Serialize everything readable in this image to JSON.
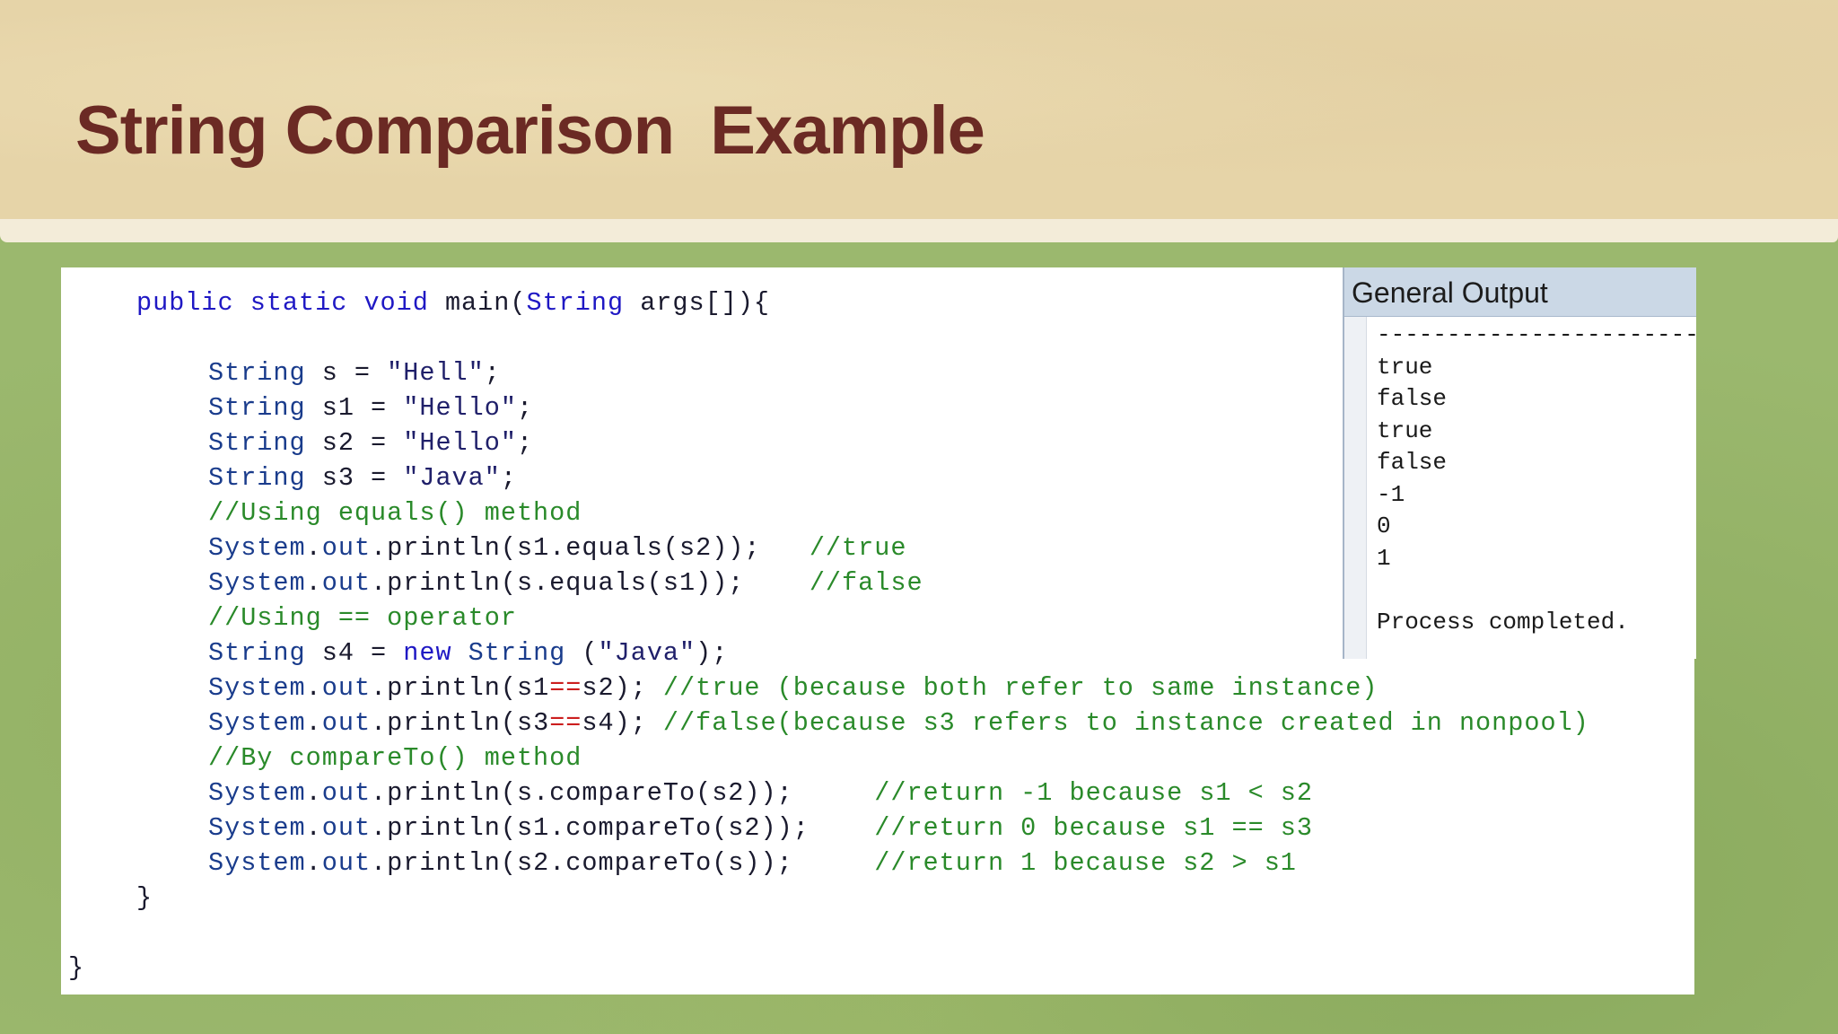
{
  "slide": {
    "title": "String Comparison  Example"
  },
  "code": {
    "lines": [
      [
        {
          "t": "public static void ",
          "c": "kw"
        },
        {
          "t": "main(",
          "c": "tx"
        },
        {
          "t": "String",
          "c": "kw"
        },
        {
          "t": " args[]){",
          "c": "tx"
        }
      ],
      [],
      [
        {
          "t": "String",
          "c": "id"
        },
        {
          "t": " s = ",
          "c": "tx"
        },
        {
          "t": "\"Hell\"",
          "c": "str"
        },
        {
          "t": ";",
          "c": "tx"
        }
      ],
      [
        {
          "t": "String",
          "c": "id"
        },
        {
          "t": " s1 = ",
          "c": "tx"
        },
        {
          "t": "\"Hello\"",
          "c": "str"
        },
        {
          "t": ";",
          "c": "tx"
        }
      ],
      [
        {
          "t": "String",
          "c": "id"
        },
        {
          "t": " s2 = ",
          "c": "tx"
        },
        {
          "t": "\"Hello\"",
          "c": "str"
        },
        {
          "t": ";",
          "c": "tx"
        }
      ],
      [
        {
          "t": "String",
          "c": "id"
        },
        {
          "t": " s3 = ",
          "c": "tx"
        },
        {
          "t": "\"Java\"",
          "c": "str"
        },
        {
          "t": ";",
          "c": "tx"
        }
      ],
      [
        {
          "t": "//Using equals() method",
          "c": "cm"
        }
      ],
      [
        {
          "t": "System",
          "c": "id"
        },
        {
          "t": ".",
          "c": "tx"
        },
        {
          "t": "out",
          "c": "id"
        },
        {
          "t": ".println(s1.equals(s2));   ",
          "c": "tx"
        },
        {
          "t": "//true",
          "c": "cm"
        }
      ],
      [
        {
          "t": "System",
          "c": "id"
        },
        {
          "t": ".",
          "c": "tx"
        },
        {
          "t": "out",
          "c": "id"
        },
        {
          "t": ".println(s.equals(s1));    ",
          "c": "tx"
        },
        {
          "t": "//false",
          "c": "cm"
        }
      ],
      [
        {
          "t": "//Using == operator",
          "c": "cm"
        }
      ],
      [
        {
          "t": "String",
          "c": "id"
        },
        {
          "t": " s4 = ",
          "c": "tx"
        },
        {
          "t": "new",
          "c": "kw"
        },
        {
          "t": " ",
          "c": "tx"
        },
        {
          "t": "String",
          "c": "id"
        },
        {
          "t": " (",
          "c": "tx"
        },
        {
          "t": "\"Java\"",
          "c": "str"
        },
        {
          "t": ");",
          "c": "tx"
        }
      ],
      [
        {
          "t": "System",
          "c": "id"
        },
        {
          "t": ".",
          "c": "tx"
        },
        {
          "t": "out",
          "c": "id"
        },
        {
          "t": ".println(s1",
          "c": "tx"
        },
        {
          "t": "==",
          "c": "op"
        },
        {
          "t": "s2); ",
          "c": "tx"
        },
        {
          "t": "//true (because both refer to same instance)",
          "c": "cm"
        }
      ],
      [
        {
          "t": "System",
          "c": "id"
        },
        {
          "t": ".",
          "c": "tx"
        },
        {
          "t": "out",
          "c": "id"
        },
        {
          "t": ".println(s3",
          "c": "tx"
        },
        {
          "t": "==",
          "c": "op"
        },
        {
          "t": "s4); ",
          "c": "tx"
        },
        {
          "t": "//false(because s3 refers to instance created in nonpool)",
          "c": "cm"
        }
      ],
      [
        {
          "t": "//By compareTo() method",
          "c": "cm"
        }
      ],
      [
        {
          "t": "System",
          "c": "id"
        },
        {
          "t": ".",
          "c": "tx"
        },
        {
          "t": "out",
          "c": "id"
        },
        {
          "t": ".println(s.compareTo(s2));     ",
          "c": "tx"
        },
        {
          "t": "//return -1 because s1 < s2",
          "c": "cm"
        }
      ],
      [
        {
          "t": "System",
          "c": "id"
        },
        {
          "t": ".",
          "c": "tx"
        },
        {
          "t": "out",
          "c": "id"
        },
        {
          "t": ".println(s1.compareTo(s2));    ",
          "c": "tx"
        },
        {
          "t": "//return 0 because s1 == s3",
          "c": "cm"
        }
      ],
      [
        {
          "t": "System",
          "c": "id"
        },
        {
          "t": ".",
          "c": "tx"
        },
        {
          "t": "out",
          "c": "id"
        },
        {
          "t": ".println(s2.compareTo(s));     ",
          "c": "tx"
        },
        {
          "t": "//return 1 because s2 > s1",
          "c": "cm"
        }
      ],
      [
        {
          "t": "}",
          "c": "tx"
        }
      ],
      [],
      [
        {
          "t": "}",
          "c": "tx"
        }
      ]
    ]
  },
  "output": {
    "title": "General Output",
    "lines": [
      "--------------------------------",
      "true",
      "false",
      "true",
      "false",
      "-1",
      "0",
      "1",
      "",
      "Process completed."
    ]
  }
}
